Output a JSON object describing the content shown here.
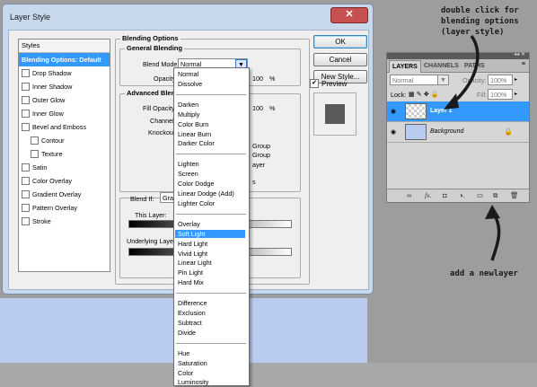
{
  "dialog": {
    "title": "Layer Style",
    "close_label": "✕",
    "styles_header": "Styles",
    "styles": [
      {
        "label": "Blending Options: Default",
        "active": true,
        "checkbox": false,
        "sub": false
      },
      {
        "label": "Drop Shadow",
        "checkbox": true,
        "sub": false
      },
      {
        "label": "Inner Shadow",
        "checkbox": true,
        "sub": false
      },
      {
        "label": "Outer Glow",
        "checkbox": true,
        "sub": false
      },
      {
        "label": "Inner Glow",
        "checkbox": true,
        "sub": false
      },
      {
        "label": "Bevel and Emboss",
        "checkbox": true,
        "sub": false
      },
      {
        "label": "Contour",
        "checkbox": true,
        "sub": true
      },
      {
        "label": "Texture",
        "checkbox": true,
        "sub": true
      },
      {
        "label": "Satin",
        "checkbox": true,
        "sub": false
      },
      {
        "label": "Color Overlay",
        "checkbox": true,
        "sub": false
      },
      {
        "label": "Gradient Overlay",
        "checkbox": true,
        "sub": false
      },
      {
        "label": "Pattern Overlay",
        "checkbox": true,
        "sub": false
      },
      {
        "label": "Stroke",
        "checkbox": true,
        "sub": false
      }
    ],
    "blending_options_title": "Blending Options",
    "general_blending_title": "General Blending",
    "blend_mode_label": "Blend Mode:",
    "blend_mode_value": "Normal",
    "opacity_label": "Opacity:",
    "opacity_value": "100",
    "percent": "%",
    "advanced_blending_title": "Advanced Blending",
    "fill_opacity_label": "Fill Opacity:",
    "fill_opacity_value": "100",
    "channels_label": "Channels:",
    "knockout_label": "Knockout:",
    "adv_partial": [
      "Group",
      "Group",
      "ayer",
      "s"
    ],
    "blend_if_label": "Blend If:",
    "blend_if_value": "Gray",
    "this_layer_label": "This Layer:",
    "underlying_layer_label": "Underlying Layer:",
    "buttons": {
      "ok": "OK",
      "cancel": "Cancel",
      "new_style": "New Style..."
    },
    "preview_label": "Preview"
  },
  "blend_menu": {
    "groups": [
      [
        "Normal",
        "Dissolve"
      ],
      [
        "Darken",
        "Multiply",
        "Color Burn",
        "Linear Burn",
        "Darker Color"
      ],
      [
        "Lighten",
        "Screen",
        "Color Dodge",
        "Linear Dodge (Add)",
        "Lighter Color"
      ],
      [
        "Overlay",
        "Soft Light",
        "Hard Light",
        "Vivid Light",
        "Linear Light",
        "Pin Light",
        "Hard Mix"
      ],
      [
        "Difference",
        "Exclusion",
        "Subtract",
        "Divide"
      ],
      [
        "Hue",
        "Saturation",
        "Color",
        "Luminosity"
      ]
    ],
    "selected": "Soft Light"
  },
  "layers_panel": {
    "tabs": [
      "LAYERS",
      "CHANNELS",
      "PATHS"
    ],
    "blend_value": "Normal",
    "opacity_label": "Opacity:",
    "opacity_value": "100%",
    "lock_label": "Lock:",
    "fill_label": "Fill:",
    "fill_value": "100%",
    "layers": [
      {
        "name": "Layer 1",
        "selected": true
      },
      {
        "name": "Background",
        "selected": false
      }
    ]
  },
  "annotations": {
    "top": [
      "double click for",
      "blending options",
      "(layer style)"
    ],
    "bottom": "add a newlayer"
  },
  "colors": {
    "accent": "#3399ff",
    "canvas": "#b9ccf0"
  }
}
